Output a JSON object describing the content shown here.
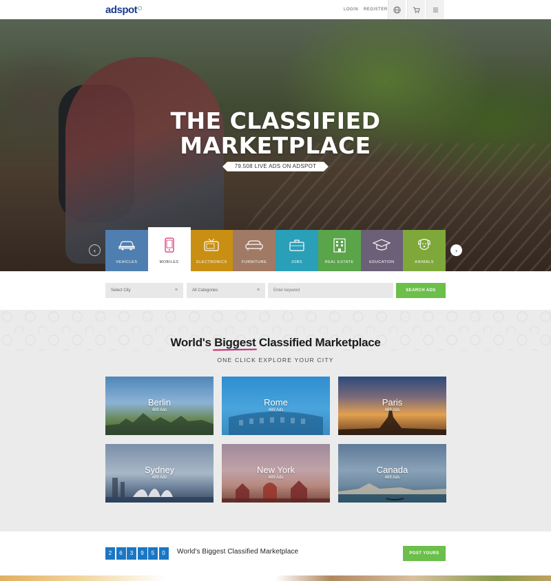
{
  "header": {
    "logo": "adspot",
    "login": "LOGIN",
    "register": "REGISTER",
    "icons": [
      "globe-icon",
      "cart-icon",
      "menu-icon"
    ]
  },
  "hero": {
    "title_line1": "THE CLASSIFIED",
    "title_line2": "MARKETPLACE",
    "badge": "79.508 LIVE ADS ON ADSPOT",
    "categories": [
      {
        "label": "VEHICLES",
        "icon": "car-icon",
        "color": "#4f7fb0"
      },
      {
        "label": "MOBILES",
        "icon": "mobile-icon",
        "color": "#ffffff",
        "active": true
      },
      {
        "label": "ELECTRONICS",
        "icon": "tv-icon",
        "color": "#c98f12"
      },
      {
        "label": "FURNITURE",
        "icon": "sofa-icon",
        "color": "#a07a64"
      },
      {
        "label": "JOBS",
        "icon": "briefcase-icon",
        "color": "#2aa0b8"
      },
      {
        "label": "REAL ESTATE",
        "icon": "building-icon",
        "color": "#5aa44a"
      },
      {
        "label": "EDUCATION",
        "icon": "graduation-cap-icon",
        "color": "#6c6078"
      },
      {
        "label": "ANIMALS",
        "icon": "dog-icon",
        "color": "#7ea83a"
      }
    ]
  },
  "search": {
    "city": "Select City",
    "category": "All Categories",
    "keyword_placeholder": "Enter keyword",
    "button": "SEARCH ADS"
  },
  "locations": {
    "title_pre": "World's",
    "title_big": "Biggest",
    "title_post": "Classified Marketplace",
    "subtitle": "ONE CLICK EXPLORE YOUR CITY",
    "cities": [
      {
        "name": "Berlin",
        "ads": "489 Ads"
      },
      {
        "name": "Rome",
        "ads": "489 Ads"
      },
      {
        "name": "Paris",
        "ads": "489 Ads"
      },
      {
        "name": "Sydney",
        "ads": "489 Ads"
      },
      {
        "name": "New York",
        "ads": "489 Ads"
      },
      {
        "name": "Canada",
        "ads": "489 Ads"
      }
    ]
  },
  "stats": {
    "digits": [
      "2",
      "6",
      "3",
      "9",
      "5",
      "0"
    ],
    "text": "World's Biggest Classified Marketplace",
    "button": "POST YOURS"
  },
  "colors": {
    "accent_green": "#6bbf4a",
    "accent_blue": "#1b77c4",
    "underline_pink": "#c8246b"
  }
}
